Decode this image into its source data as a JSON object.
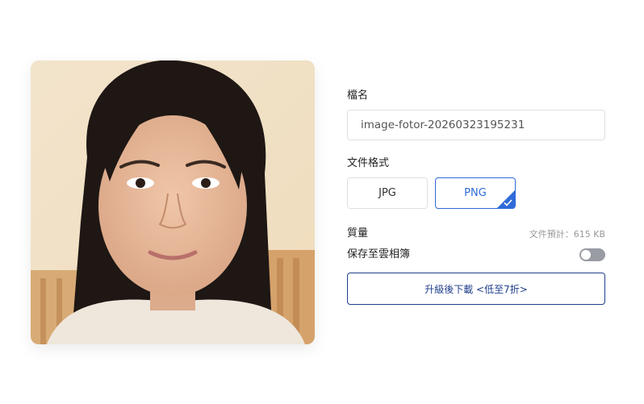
{
  "panel": {
    "filename_label": "檔名",
    "filename_value": "image-fotor-20260323195231",
    "format_label": "文件格式",
    "formats": [
      "JPG",
      "PNG"
    ],
    "selected_format": "PNG",
    "quality_label": "質量",
    "size_estimate": "文件預計：615 KB",
    "cloud_label": "保存至雲相簿",
    "cloud_enabled": false,
    "download_button": "升級後下載 <低至7折>"
  },
  "colors": {
    "accent": "#2f6bd8",
    "download_border": "#1f3e8a",
    "toggle_off": "#999ca3"
  },
  "icons": [
    "checkmark-icon"
  ]
}
